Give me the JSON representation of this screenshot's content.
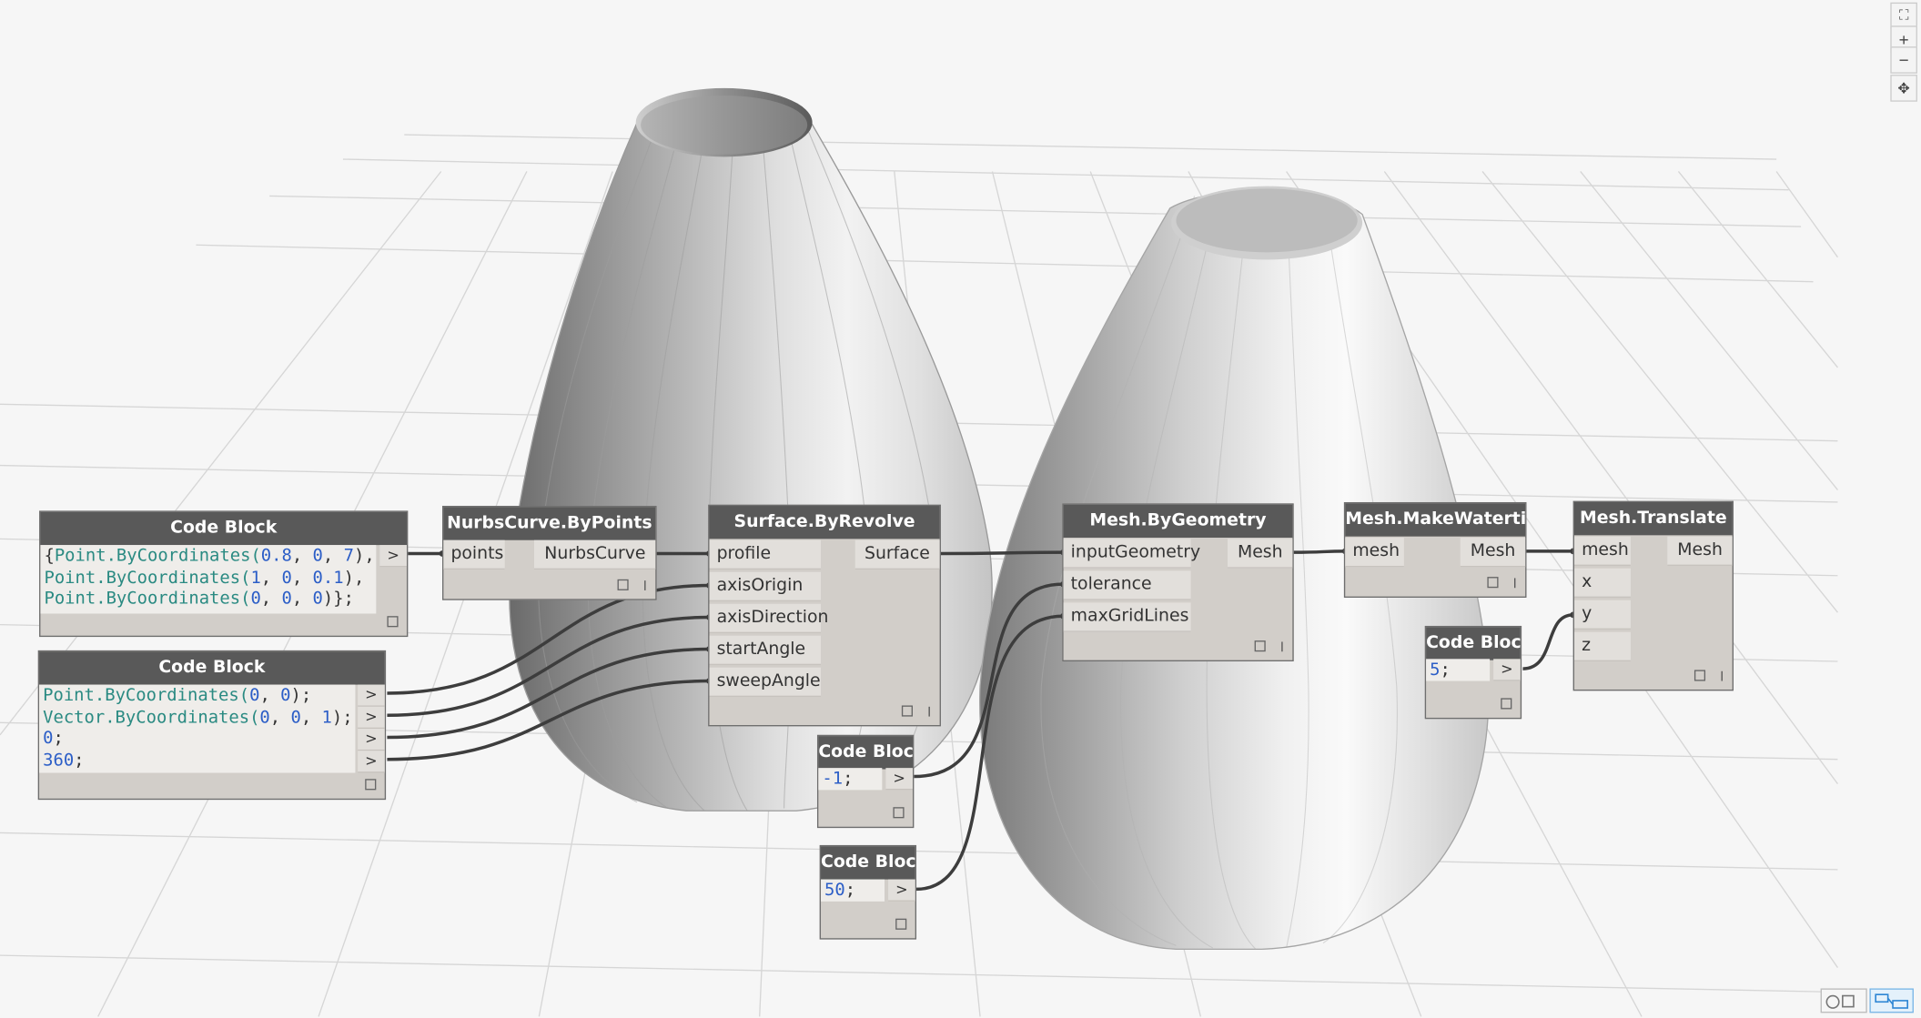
{
  "nodes": {
    "code_block_points": {
      "title": "Code Block",
      "lines": [
        [
          {
            "t": "{",
            "c": "dot"
          },
          {
            "t": "Point",
            "c": "class"
          },
          {
            "t": ".ByCoordinates(",
            "c": "class"
          },
          {
            "t": "0.8",
            "c": "num"
          },
          {
            "t": ", ",
            "c": "dot"
          },
          {
            "t": "0",
            "c": "num"
          },
          {
            "t": ", ",
            "c": "dot"
          },
          {
            "t": "7",
            "c": "num"
          },
          {
            "t": "),",
            "c": "dot"
          }
        ],
        [
          {
            "t": "Point",
            "c": "class"
          },
          {
            "t": ".ByCoordinates(",
            "c": "class"
          },
          {
            "t": "1",
            "c": "num"
          },
          {
            "t": ", ",
            "c": "dot"
          },
          {
            "t": "0",
            "c": "num"
          },
          {
            "t": ", ",
            "c": "dot"
          },
          {
            "t": "0.1",
            "c": "num"
          },
          {
            "t": "),",
            "c": "dot"
          }
        ],
        [
          {
            "t": "Point",
            "c": "class"
          },
          {
            "t": ".ByCoordinates(",
            "c": "class"
          },
          {
            "t": "0",
            "c": "num"
          },
          {
            "t": ", ",
            "c": "dot"
          },
          {
            "t": "0",
            "c": "num"
          },
          {
            "t": ", ",
            "c": "dot"
          },
          {
            "t": "0",
            "c": "num"
          },
          {
            "t": ")};",
            "c": "dot"
          }
        ]
      ],
      "output": ">"
    },
    "code_block_params": {
      "title": "Code Block",
      "lines": [
        [
          {
            "t": "Point",
            "c": "class"
          },
          {
            "t": ".ByCoordinates(",
            "c": "class"
          },
          {
            "t": "0",
            "c": "num"
          },
          {
            "t": ", ",
            "c": "dot"
          },
          {
            "t": "0",
            "c": "num"
          },
          {
            "t": ");",
            "c": "dot"
          }
        ],
        [
          {
            "t": "Vector",
            "c": "class"
          },
          {
            "t": ".ByCoordinates(",
            "c": "class"
          },
          {
            "t": "0",
            "c": "num"
          },
          {
            "t": ", ",
            "c": "dot"
          },
          {
            "t": "0",
            "c": "num"
          },
          {
            "t": ", ",
            "c": "dot"
          },
          {
            "t": "1",
            "c": "num"
          },
          {
            "t": ");",
            "c": "dot"
          }
        ],
        [
          {
            "t": "0",
            "c": "num"
          },
          {
            "t": ";",
            "c": "dot"
          }
        ],
        [
          {
            "t": "360",
            "c": "num"
          },
          {
            "t": ";",
            "c": "dot"
          }
        ]
      ],
      "outputs": [
        ">",
        ">",
        ">",
        ">"
      ]
    },
    "nurbs_curve": {
      "title": "NurbsCurve.ByPoints",
      "inputs": [
        "points"
      ],
      "outputs": [
        "NurbsCurve"
      ]
    },
    "surface_revolve": {
      "title": "Surface.ByRevolve",
      "inputs": [
        "profile",
        "axisOrigin",
        "axisDirection",
        "startAngle",
        "sweepAngle"
      ],
      "outputs": [
        "Surface"
      ]
    },
    "code_block_neg1": {
      "title": "Code Block",
      "lines": [
        [
          {
            "t": "-1",
            "c": "num"
          },
          {
            "t": ";",
            "c": "dot"
          }
        ]
      ],
      "output": ">"
    },
    "code_block_50": {
      "title": "Code Block",
      "lines": [
        [
          {
            "t": "50",
            "c": "num"
          },
          {
            "t": ";",
            "c": "dot"
          }
        ]
      ],
      "output": ">"
    },
    "mesh_by_geometry": {
      "title": "Mesh.ByGeometry",
      "inputs": [
        "inputGeometry",
        "tolerance",
        "maxGridLines"
      ],
      "outputs": [
        "Mesh"
      ]
    },
    "mesh_watertight": {
      "title": "Mesh.MakeWatertight",
      "inputs": [
        "mesh"
      ],
      "outputs": [
        "Mesh"
      ]
    },
    "code_block_5": {
      "title": "Code Block",
      "lines": [
        [
          {
            "t": "5",
            "c": "num"
          },
          {
            "t": ";",
            "c": "dot"
          }
        ]
      ],
      "output": ">"
    },
    "mesh_translate": {
      "title": "Mesh.Translate",
      "inputs": [
        "mesh",
        "x",
        "y",
        "z"
      ],
      "outputs": [
        "Mesh"
      ]
    }
  },
  "nav_controls": {
    "fit_icon": "fit-view-icon",
    "zoom_in": "+",
    "zoom_out": "−",
    "pan_icon": "pan-icon"
  },
  "view_toggle": {
    "geometry_icon": "geometry-view-icon",
    "graph_icon": "graph-view-icon"
  },
  "colors": {
    "node_header": "#595959",
    "node_body": "#d2cec9",
    "wire": "#3d3d3d",
    "code_class": "#2a8a82",
    "code_number": "#2c5ec7",
    "background": "#f6f6f6",
    "grid": "#d8d8d8"
  }
}
